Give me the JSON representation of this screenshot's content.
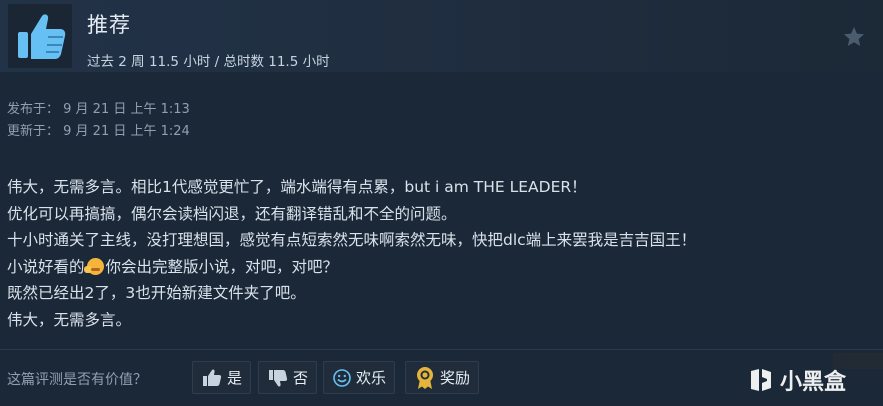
{
  "review": {
    "verdict": "推荐",
    "hours": "过去 2 周 11.5 小时 / 总时数 11.5 小时",
    "posted": "发布于：  9 月 21 日 上午 1:13",
    "updated": "更新于：  9 月 21 日 上午 1:24",
    "lines": [
      "伟大，无需多言。相比1代感觉更忙了，端水端得有点累，but i am THE LEADER！",
      "优化可以再搞搞，偶尔会读档闪退，还有翻译错乱和不全的问题。",
      "十小时通关了主线，没打理想国，感觉有点短索然无味啊索然无味，快把dlc端上来罢我是吉吉国王！",
      "小说好看的",
      "你会出完整版小说，对吧，对吧？",
      "既然已经出2了，3也开始新建文件夹了吧。",
      "伟大，无需多言。"
    ]
  },
  "footer": {
    "question": "这篇评测是否有价值？",
    "buttons": {
      "yes": "是",
      "no": "否",
      "funny": "欢乐",
      "award": "奖励"
    }
  },
  "watermark": {
    "text": "小黑盒"
  },
  "icons": {
    "recommend": "thumbs-up-icon",
    "favorite": "star-icon",
    "emoji": "hugging-face-emoji-icon"
  },
  "colors": {
    "background": "#1b2838",
    "thumb_blue": "#66c0f4",
    "award_gold": "#e5b43a"
  }
}
